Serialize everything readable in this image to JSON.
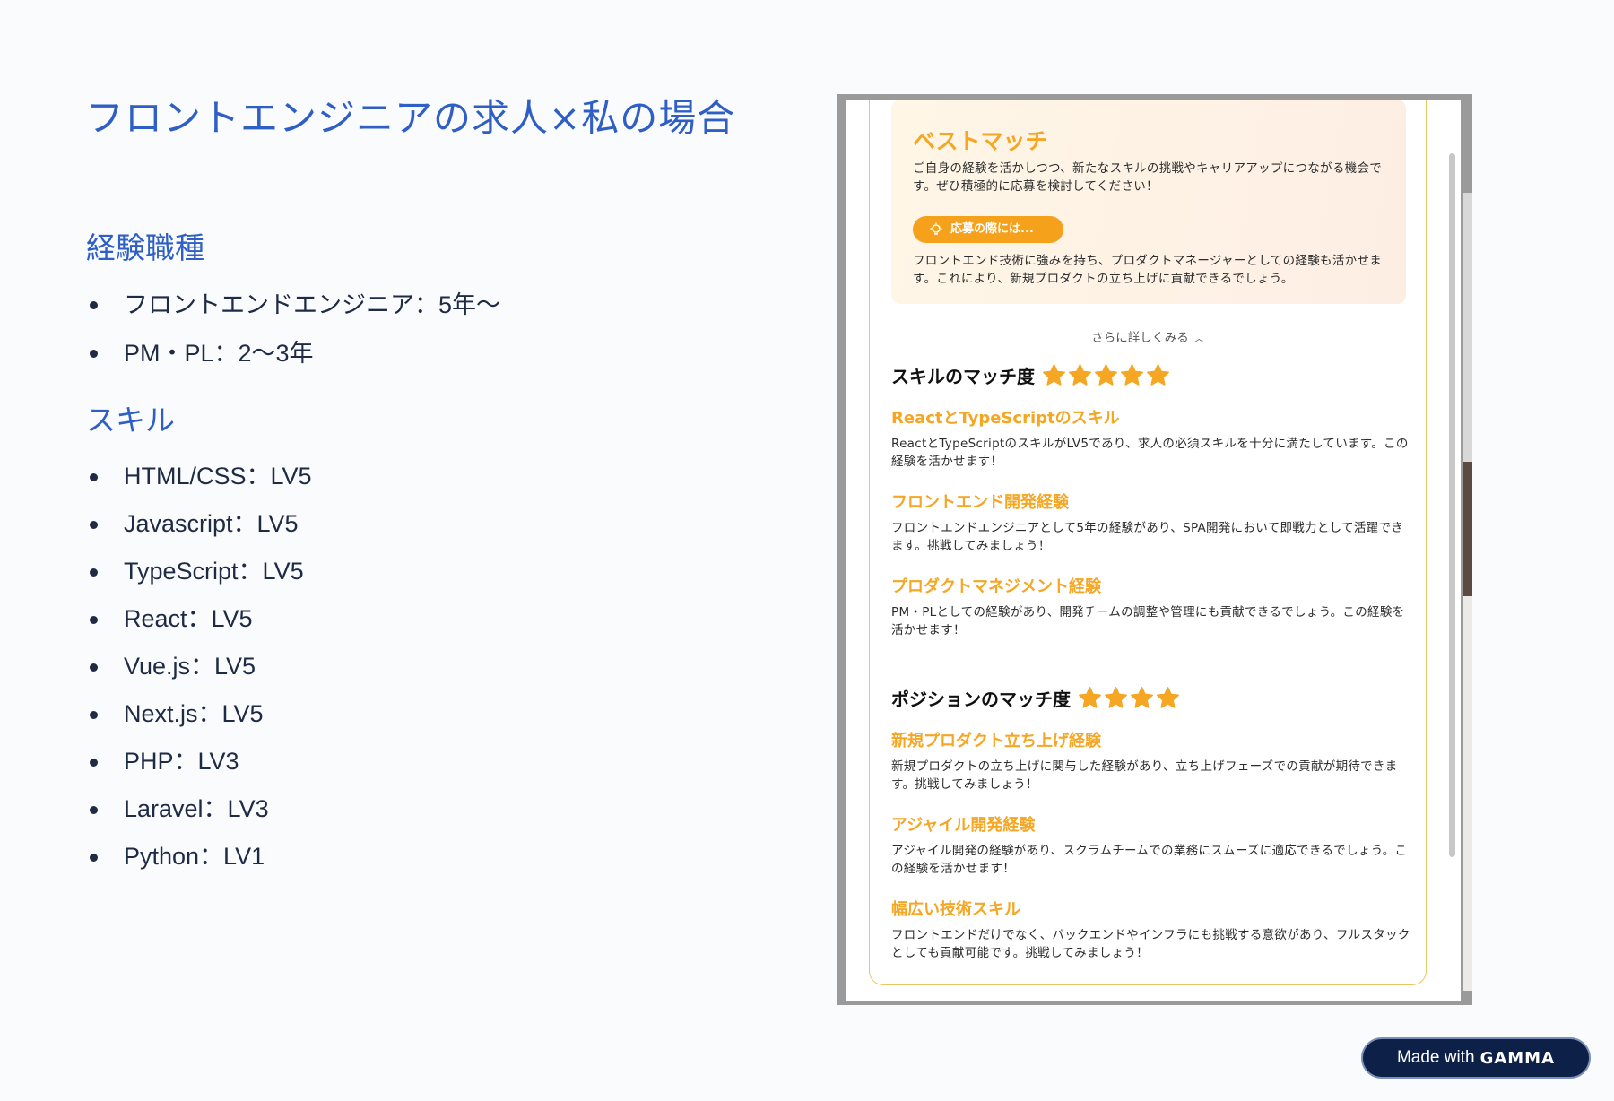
{
  "slide": {
    "title": "フロントエンジニアの求人×私の場合",
    "experience_heading": "経験職種",
    "experience_items": [
      "フロントエンドエンジニア：5年〜",
      "PM・PL：2〜3年"
    ],
    "skills_heading": "スキル",
    "skill_items": [
      "HTML/CSS：LV5",
      "Javascript：LV5",
      "TypeScript：LV5",
      "React：LV5",
      "Vue.js：LV5",
      "Next.js：LV5",
      "PHP：LV3",
      "Laravel：LV3",
      "Python：LV1"
    ]
  },
  "screenshot": {
    "best_match": {
      "title": "ベストマッチ",
      "description": "ご自身の経験を活かしつつ、新たなスキルの挑戦やキャリアアップにつながる機会です。ぜひ積極的に応募を検討してください！",
      "apply_badge": "応募の際には...",
      "apply_text": "フロントエンド技術に強みを持ち、プロダクトマネージャーとしての経験も活かせます。これにより、新規プロダクトの立ち上げに貢献できるでしょう。"
    },
    "more_link": "さらに詳しくみる",
    "skill_match": {
      "heading": "スキルのマッチ度",
      "stars": 5,
      "items": [
        {
          "title": "ReactとTypeScriptのスキル",
          "desc": "ReactとTypeScriptのスキルがLV5であり、求人の必須スキルを十分に満たしています。この経験を活かせます！"
        },
        {
          "title": "フロントエンド開発経験",
          "desc": "フロントエンドエンジニアとして5年の経験があり、SPA開発において即戦力として活躍できます。挑戦してみましょう！"
        },
        {
          "title": "プロダクトマネジメント経験",
          "desc": "PM・PLとしての経験があり、開発チームの調整や管理にも貢献できるでしょう。この経験を活かせます！"
        }
      ]
    },
    "position_match": {
      "heading": "ポジションのマッチ度",
      "stars": 4,
      "items": [
        {
          "title": "新規プロダクト立ち上げ経験",
          "desc": "新規プロダクトの立ち上げに関与した経験があり、立ち上げフェーズでの貢献が期待できます。挑戦してみましょう！"
        },
        {
          "title": "アジャイル開発経験",
          "desc": "アジャイル開発の経験があり、スクラムチームでの業務にスムーズに適応できるでしょう。この経験を活かせます！"
        },
        {
          "title": "幅広い技術スキル",
          "desc": "フロントエンドだけでなく、バックエンドやインフラにも挑戦する意欲があり、フルスタックとしても貢献可能です。挑戦してみましょう！"
        }
      ]
    },
    "accent_color": "#f5a623"
  },
  "badge": {
    "made_with": "Made with",
    "brand": "GAMMA"
  }
}
